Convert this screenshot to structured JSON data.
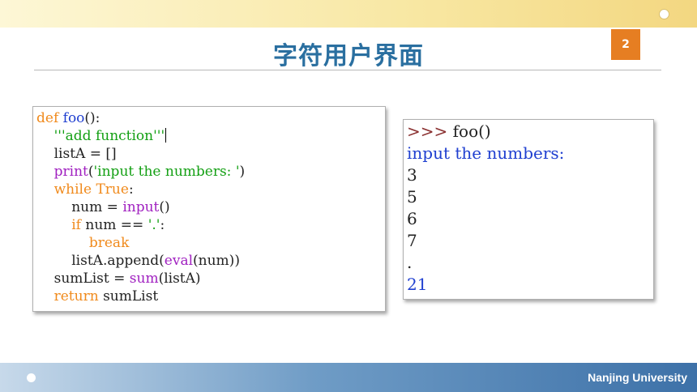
{
  "slide": {
    "title": "字符用户界面",
    "page_number": "2",
    "footer": "Nanjing University"
  },
  "colors": {
    "keyword": "#f08a1c",
    "function": "#1f3fd0",
    "string": "#14a014",
    "builtin": "#a020c0",
    "title": "#2a6fa0",
    "page_badge": "#e67e22"
  },
  "code": {
    "l1_kw": "def",
    "l1_fn": "foo",
    "l1_rest": "():",
    "l2_str": "'''add function'''",
    "l3_plain": "listA = []",
    "l4_bi": "print",
    "l4_paren": "(",
    "l4_str": "'input the numbers: '",
    "l4_close": ")",
    "l5_kw": "while True",
    "l5_rest": ":",
    "l6_plain": "num = ",
    "l6_bi": "input",
    "l6_rest": "()",
    "l7_kw": "if",
    "l7_plain": " num == ",
    "l7_str": "'.'",
    "l7_rest": ":",
    "l8_kw": "break",
    "l9_plain": "listA.append(",
    "l9_bi": "eval",
    "l9_rest": "(num))",
    "l10_plain": "sumList = ",
    "l10_bi": "sum",
    "l10_rest": "(listA)",
    "l11_kw": "return",
    "l11_plain": " sumList"
  },
  "output": {
    "prompt": ">>>",
    "call": " foo()",
    "line2": "input the numbers:",
    "inputs": [
      "3",
      "5",
      "6",
      "7",
      "."
    ],
    "result": "21"
  }
}
